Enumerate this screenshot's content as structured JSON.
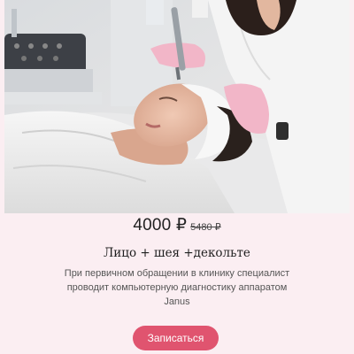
{
  "service": {
    "price_current": "4000 ₽",
    "price_old": "5480 ₽",
    "title": "Лицо + шея +декольте",
    "description": "При первичном обращении в клинику специалист проводит компьютерную диагностику аппаратом Janus",
    "cta_label": "Записаться"
  },
  "colors": {
    "background": "#fbeef2",
    "accent": "#e0546f"
  },
  "image": {
    "subject": "cosmetology facial procedure photo"
  }
}
